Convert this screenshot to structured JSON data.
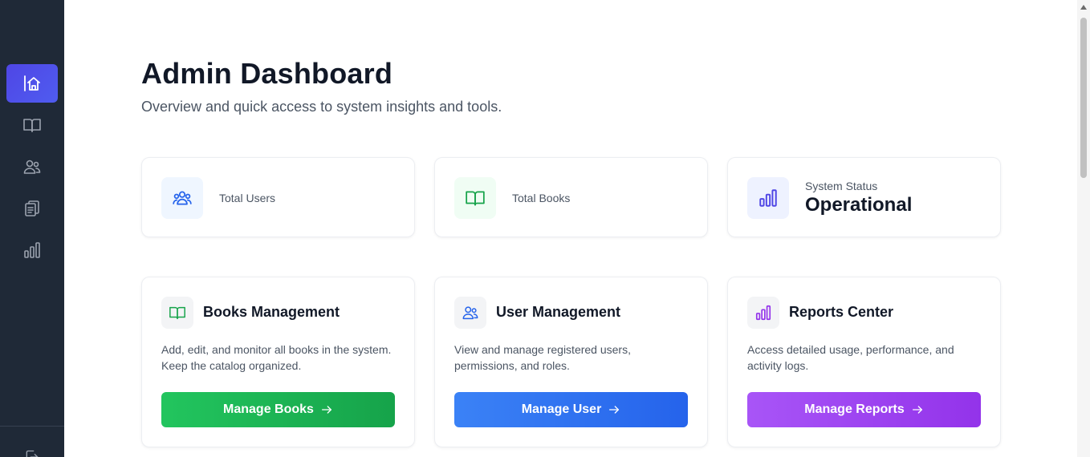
{
  "header": {
    "title": "Admin Dashboard",
    "subtitle": "Overview and quick access to system insights and tools."
  },
  "sidebar": {
    "items": [
      {
        "icon": "home-icon",
        "active": true
      },
      {
        "icon": "book-icon",
        "active": false
      },
      {
        "icon": "users-icon",
        "active": false
      },
      {
        "icon": "clipboard-icon",
        "active": false
      },
      {
        "icon": "bar-chart-icon",
        "active": false
      }
    ],
    "bottom_icon": "logout-icon"
  },
  "stats": [
    {
      "label": "Total Users",
      "icon": "users-group-icon",
      "color": "#2563eb",
      "bg": "#eff6ff"
    },
    {
      "label": "Total Books",
      "icon": "book-open-icon",
      "color": "#16a34a",
      "bg": "#f0fdf4"
    },
    {
      "label": "System Status",
      "value": "Operational",
      "icon": "bar-chart-icon",
      "color": "#4f46e5",
      "bg": "#eef2ff"
    }
  ],
  "features": [
    {
      "title": "Books Management",
      "description": "Add, edit, and monitor all books in the system. Keep the catalog organized.",
      "button": "Manage Books",
      "icon": "book-open-icon",
      "icon_color": "#16a34a",
      "gradient": [
        "#22c55e",
        "#16a34a"
      ]
    },
    {
      "title": "User Management",
      "description": "View and manage registered users, permissions, and roles.",
      "button": "Manage User",
      "icon": "users-icon",
      "icon_color": "#2563eb",
      "gradient": [
        "#3b82f6",
        "#2563eb"
      ]
    },
    {
      "title": "Reports Center",
      "description": "Access detailed usage, performance, and activity logs.",
      "button": "Manage Reports",
      "icon": "bar-chart-icon",
      "icon_color": "#9333ea",
      "gradient": [
        "#a855f7",
        "#9333ea"
      ]
    }
  ]
}
